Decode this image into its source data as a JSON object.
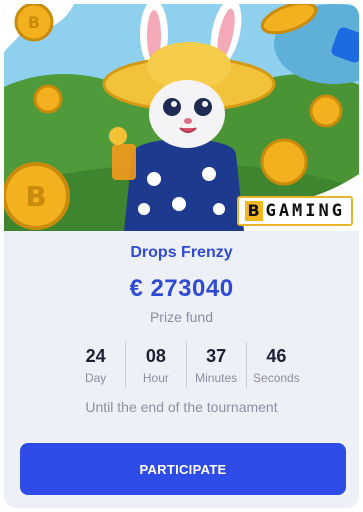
{
  "tournament": {
    "title": "Drops Frenzy",
    "prize_amount": "€ 273040",
    "prize_label": "Prize fund",
    "provider": {
      "letter": "B",
      "name": "GAMING"
    },
    "countdown": [
      {
        "value": "24",
        "unit": "Day"
      },
      {
        "value": "08",
        "unit": "Hour"
      },
      {
        "value": "37",
        "unit": "Minutes"
      },
      {
        "value": "46",
        "unit": "Seconds"
      }
    ],
    "until_text": "Until the end of the tournament",
    "participate_label": "PARTICIPATE"
  },
  "colors": {
    "accent": "#2f4bd6",
    "button": "#2f4ce8",
    "card_bg": "#eef0f8",
    "muted": "#8a8fa3"
  }
}
